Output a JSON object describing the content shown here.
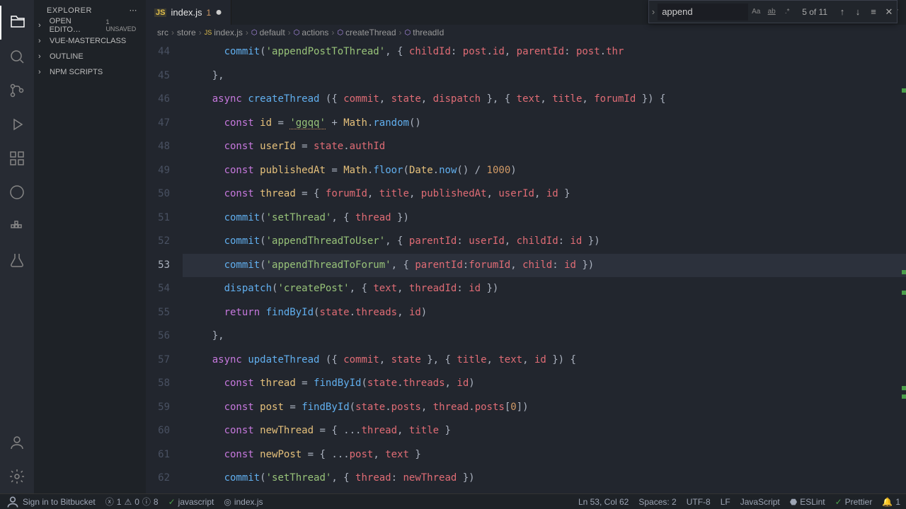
{
  "explorer": {
    "title": "EXPLORER",
    "sections": {
      "open_editors": "OPEN EDITO…",
      "unsaved": "1 UNSAVED",
      "project": "VUE-MASTERCLASS",
      "outline": "OUTLINE",
      "npm": "NPM SCRIPTS"
    }
  },
  "tab": {
    "filename": "index.js",
    "problem_count": "1"
  },
  "breadcrumbs": [
    "src",
    "store",
    "index.js",
    "default",
    "actions",
    "createThread",
    "threadId"
  ],
  "find": {
    "value": "append",
    "count": "5 of 11"
  },
  "gutter_start": 44,
  "active_line": 53,
  "code_lines": [
    {
      "n": 44,
      "html": "      <span class='fn'>commit</span>(<span class='str'>'appendPostToThread'</span>, { <span class='prop'>childId</span>: <span class='ident'>post</span>.<span class='prop'>id</span>, <span class='prop'>parentId</span>: <span class='ident'>post</span>.<span class='prop'>thr</span>"
    },
    {
      "n": 45,
      "html": "    },"
    },
    {
      "n": 46,
      "html": "    <span class='kw'>async</span> <span class='fn'>createThread</span> ({ <span class='ident'>commit</span>, <span class='ident'>state</span>, <span class='ident'>dispatch</span> }, { <span class='ident'>text</span>, <span class='ident'>title</span>, <span class='ident'>forumId</span> }) {"
    },
    {
      "n": 47,
      "html": "      <span class='kw'>const</span> <span class='const-name'>id</span> = <span class='str warn-underline'>'ggqq'</span> + <span class='obj'>Math</span>.<span class='fn'>random</span>()"
    },
    {
      "n": 48,
      "html": "      <span class='kw'>const</span> <span class='const-name'>userId</span> = <span class='ident'>state</span>.<span class='prop'>authId</span>"
    },
    {
      "n": 49,
      "html": "      <span class='kw'>const</span> <span class='const-name'>publishedAt</span> = <span class='obj'>Math</span>.<span class='fn'>floor</span>(<span class='obj'>Date</span>.<span class='fn'>now</span>() / <span class='num'>1000</span>)"
    },
    {
      "n": 50,
      "html": "      <span class='kw'>const</span> <span class='const-name'>thread</span> = { <span class='ident'>forumId</span>, <span class='ident'>title</span>, <span class='ident'>publishedAt</span>, <span class='ident'>userId</span>, <span class='ident'>id</span> }"
    },
    {
      "n": 51,
      "html": "      <span class='fn'>commit</span>(<span class='str'>'setThread'</span>, { <span class='ident'>thread</span> })"
    },
    {
      "n": 52,
      "html": "      <span class='fn'>commit</span>(<span class='str'>'appendThreadToUser'</span>, { <span class='prop'>parentId</span>: <span class='ident'>userId</span>, <span class='prop'>childId</span>: <span class='ident'>id</span> })"
    },
    {
      "n": 53,
      "html": "      <span class='fn'>commit</span>(<span class='str'>'appendThreadToForum'</span>, { <span class='prop'>parentId</span>:<span class='ident'>forumId</span>, <span class='prop'>child</span>: <span class='ident'>id</span> })",
      "hl": true
    },
    {
      "n": 54,
      "html": "      <span class='fn'>dispatch</span>(<span class='str'>'createPost'</span>, { <span class='ident'>text</span>, <span class='prop'>threadId</span>: <span class='ident'>id</span> })"
    },
    {
      "n": 55,
      "html": "      <span class='kw'>return</span> <span class='fn'>findById</span>(<span class='ident'>state</span>.<span class='prop'>threads</span>, <span class='ident'>id</span>)"
    },
    {
      "n": 56,
      "html": "    },"
    },
    {
      "n": 57,
      "html": "    <span class='kw'>async</span> <span class='fn'>updateThread</span> ({ <span class='ident'>commit</span>, <span class='ident'>state</span> }, { <span class='ident'>title</span>, <span class='ident'>text</span>, <span class='ident'>id</span> }) {"
    },
    {
      "n": 58,
      "html": "      <span class='kw'>const</span> <span class='const-name'>thread</span> = <span class='fn'>findById</span>(<span class='ident'>state</span>.<span class='prop'>threads</span>, <span class='ident'>id</span>)"
    },
    {
      "n": 59,
      "html": "      <span class='kw'>const</span> <span class='const-name'>post</span> = <span class='fn'>findById</span>(<span class='ident'>state</span>.<span class='prop'>posts</span>, <span class='ident'>thread</span>.<span class='prop'>posts</span>[<span class='num'>0</span>])"
    },
    {
      "n": 60,
      "html": "      <span class='kw'>const</span> <span class='const-name'>newThread</span> = { ...<span class='ident'>thread</span>, <span class='ident'>title</span> }"
    },
    {
      "n": 61,
      "html": "      <span class='kw'>const</span> <span class='const-name'>newPost</span> = { ...<span class='ident'>post</span>, <span class='ident'>text</span> }"
    },
    {
      "n": 62,
      "html": "      <span class='fn'>commit</span>(<span class='str'>'setThread'</span>, { <span class='prop'>thread</span>: <span class='ident'>newThread</span> })"
    }
  ],
  "status": {
    "signin": "Sign in to Bitbucket",
    "err": "1",
    "warn": "0",
    "info": "8",
    "lang_left": "javascript",
    "file": "index.js",
    "pos": "Ln 53, Col 62",
    "spaces": "Spaces: 2",
    "enc": "UTF-8",
    "eol": "LF",
    "lang": "JavaScript",
    "eslint": "ESLint",
    "prettier": "Prettier",
    "bell": "1"
  }
}
